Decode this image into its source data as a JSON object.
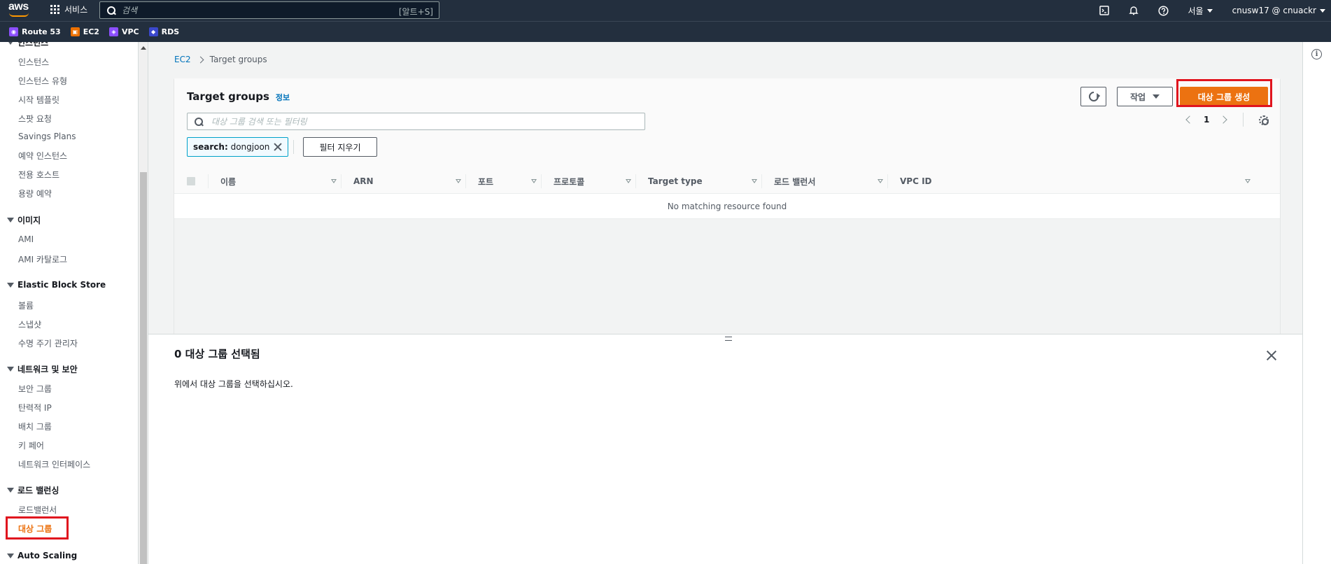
{
  "topnav": {
    "logo_text": "aws",
    "services_label": "서비스",
    "search_placeholder": "검색",
    "search_shortcut": "[알트+S]",
    "region": "서울",
    "account": "cnusw17 @ cnuackr"
  },
  "favorites": [
    {
      "label": "Route 53",
      "color": "#8c4fff",
      "icon": "route53-icon"
    },
    {
      "label": "EC2",
      "color": "#ed7100",
      "icon": "ec2-icon"
    },
    {
      "label": "VPC",
      "color": "#8c4fff",
      "icon": "vpc-icon"
    },
    {
      "label": "RDS",
      "color": "#3b48cc",
      "icon": "rds-icon"
    }
  ],
  "sidebar": {
    "top_partial": "인스턴스",
    "instances": [
      "인스턴스",
      "인스턴스 유형",
      "시작 템플릿",
      "스팟 요청",
      "Savings Plans",
      "예약 인스턴스",
      "전용 호스트",
      "용량 예약"
    ],
    "images_title": "이미지",
    "images": [
      "AMI",
      "AMI 카탈로그"
    ],
    "ebs_title": "Elastic Block Store",
    "ebs": [
      "볼륨",
      "스냅샷",
      "수명 주기 관리자"
    ],
    "network_title": "네트워크 및 보안",
    "network": [
      "보안 그룹",
      "탄력적 IP",
      "배치 그룹",
      "키 페어",
      "네트워크 인터페이스"
    ],
    "lb_title": "로드 밸런싱",
    "lb": [
      "로드밸런서",
      "대상 그룹"
    ],
    "as_title": "Auto Scaling"
  },
  "breadcrumb": {
    "root": "EC2",
    "current": "Target groups"
  },
  "panel": {
    "title": "Target groups",
    "info": "정보",
    "actions_label": "작업",
    "create_label": "대상 그룹 생성",
    "filter_placeholder": "대상 그룹 검색 또는 필터링",
    "token_key": "search:",
    "token_value": "dongjoon",
    "clear_filters": "필터 지우기",
    "page": "1",
    "columns": [
      "이름",
      "ARN",
      "포트",
      "프로토콜",
      "Target type",
      "로드 밸런서",
      "VPC ID"
    ],
    "empty_message": "No matching resource found"
  },
  "split": {
    "title": "0 대상 그룹 선택됨",
    "message": "위에서 대상 그룹을 선택하십시오."
  },
  "colors": {
    "nav_bg": "#232f3e",
    "primary": "#ec7211",
    "highlight": "#e0141e",
    "link": "#0073bb"
  }
}
